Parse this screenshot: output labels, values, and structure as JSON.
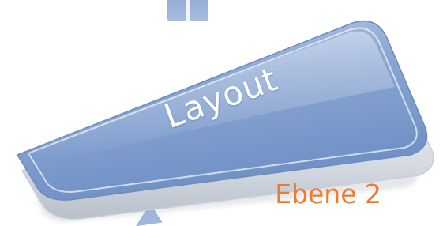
{
  "button": {
    "label": "Layout",
    "fill_color": "#7f9bcb",
    "fill_color_light": "#b8c9e6",
    "edge_color": "#d6dde6"
  },
  "caption": {
    "text": "Ebene 2",
    "color": "#ee7a2c"
  },
  "background_shapes": {
    "color": "#9fb6dd"
  }
}
